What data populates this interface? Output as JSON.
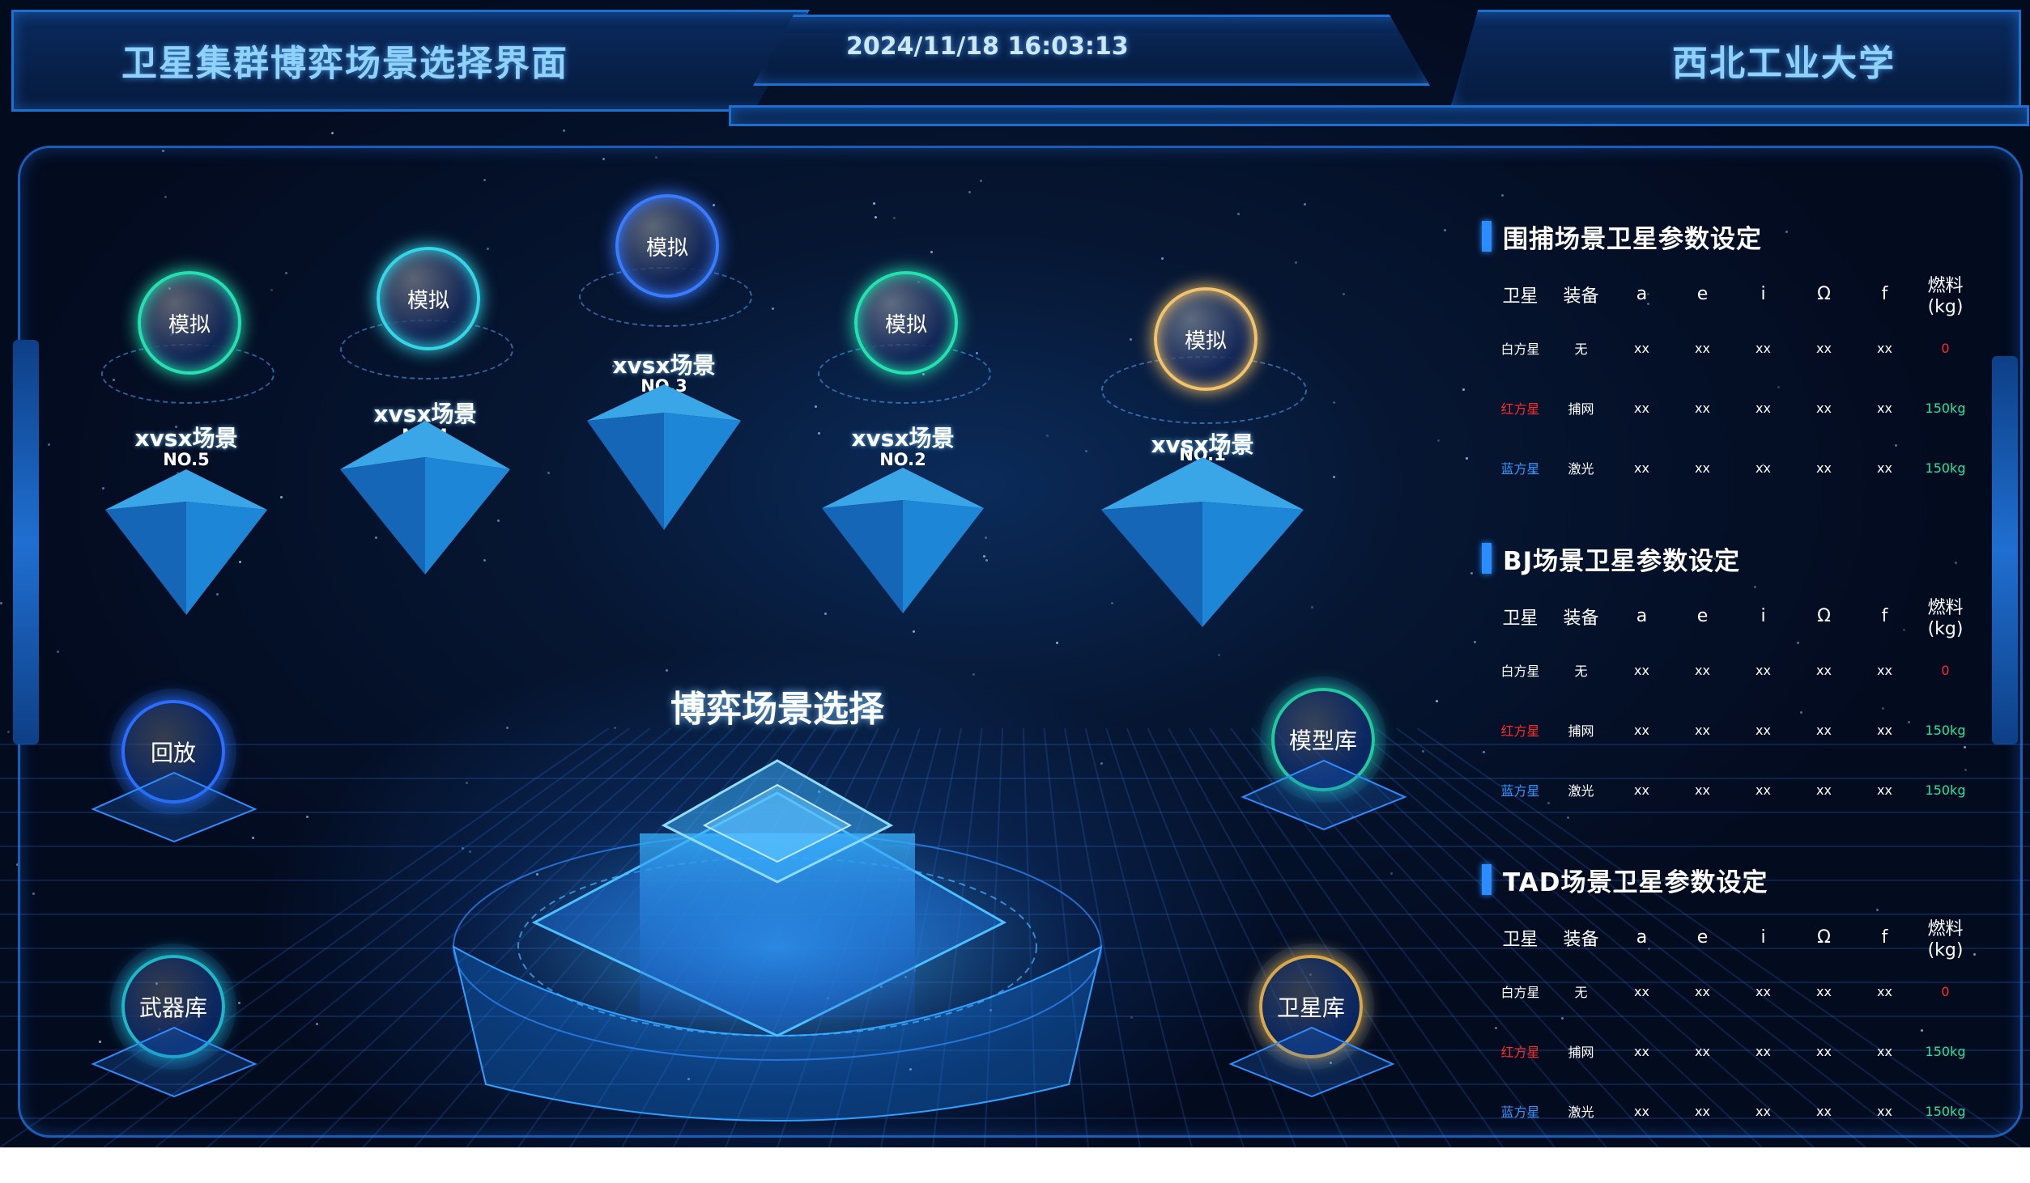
{
  "header": {
    "title": "卫星集群博弈场景选择界面",
    "datetime": "2024/11/18 16:03:13",
    "org": "西北工业大学"
  },
  "scenes": [
    {
      "orb_label": "模拟",
      "name": "xvsx场景",
      "no": "NO.5",
      "color": "#25e0b0"
    },
    {
      "orb_label": "模拟",
      "name": "xvsx场景",
      "no": "NO.4",
      "color": "#35d6e6"
    },
    {
      "orb_label": "模拟",
      "name": "xvsx场景",
      "no": "NO.3",
      "color": "#3a7cff"
    },
    {
      "orb_label": "模拟",
      "name": "xvsx场景",
      "no": "NO.2",
      "color": "#25e0b0"
    },
    {
      "orb_label": "模拟",
      "name": "xvsx场景",
      "no": "NO.1",
      "color": "#f2c36a"
    }
  ],
  "center": {
    "title": "博弈场景选择"
  },
  "nav": {
    "replay": {
      "label": "回放",
      "color": "#2b6dff"
    },
    "weapons": {
      "label": "武器库",
      "color": "#1fb6c8"
    },
    "models": {
      "label": "模型库",
      "color": "#22c9a0"
    },
    "satellites": {
      "label": "卫星库",
      "color": "#d9a84a"
    }
  },
  "panels": [
    {
      "title": "围捕场景卫星参数设定",
      "headers": [
        "卫星",
        "装备",
        "a",
        "e",
        "i",
        "Ω",
        "f",
        "燃料(kg)"
      ],
      "rows": [
        {
          "name": "白方星",
          "equip": "无",
          "a": "xx",
          "e": "xx",
          "i": "xx",
          "omega": "xx",
          "f": "xx",
          "fuel": "0"
        },
        {
          "name": "红方星",
          "equip": "捕网",
          "a": "xx",
          "e": "xx",
          "i": "xx",
          "omega": "xx",
          "f": "xx",
          "fuel": "150kg"
        },
        {
          "name": "蓝方星",
          "equip": "激光",
          "a": "xx",
          "e": "xx",
          "i": "xx",
          "omega": "xx",
          "f": "xx",
          "fuel": "150kg"
        }
      ]
    },
    {
      "title": "BJ场景卫星参数设定",
      "headers": [
        "卫星",
        "装备",
        "a",
        "e",
        "i",
        "Ω",
        "f",
        "燃料(kg)"
      ],
      "rows": [
        {
          "name": "白方星",
          "equip": "无",
          "a": "xx",
          "e": "xx",
          "i": "xx",
          "omega": "xx",
          "f": "xx",
          "fuel": "0"
        },
        {
          "name": "红方星",
          "equip": "捕网",
          "a": "xx",
          "e": "xx",
          "i": "xx",
          "omega": "xx",
          "f": "xx",
          "fuel": "150kg"
        },
        {
          "name": "蓝方星",
          "equip": "激光",
          "a": "xx",
          "e": "xx",
          "i": "xx",
          "omega": "xx",
          "f": "xx",
          "fuel": "150kg"
        }
      ]
    },
    {
      "title": "TAD场景卫星参数设定",
      "headers": [
        "卫星",
        "装备",
        "a",
        "e",
        "i",
        "Ω",
        "f",
        "燃料(kg)"
      ],
      "rows": [
        {
          "name": "白方星",
          "equip": "无",
          "a": "xx",
          "e": "xx",
          "i": "xx",
          "omega": "xx",
          "f": "xx",
          "fuel": "0"
        },
        {
          "name": "红方星",
          "equip": "捕网",
          "a": "xx",
          "e": "xx",
          "i": "xx",
          "omega": "xx",
          "f": "xx",
          "fuel": "150kg"
        },
        {
          "name": "蓝方星",
          "equip": "激光",
          "a": "xx",
          "e": "xx",
          "i": "xx",
          "omega": "xx",
          "f": "xx",
          "fuel": "150kg"
        }
      ]
    }
  ],
  "colors": {
    "accent": "#2a8cff",
    "red_side": "#ff2a2a",
    "blue_side": "#2f97ff",
    "fuel_ok": "#1ee6a0",
    "fuel_zero": "#ff2a2a"
  }
}
